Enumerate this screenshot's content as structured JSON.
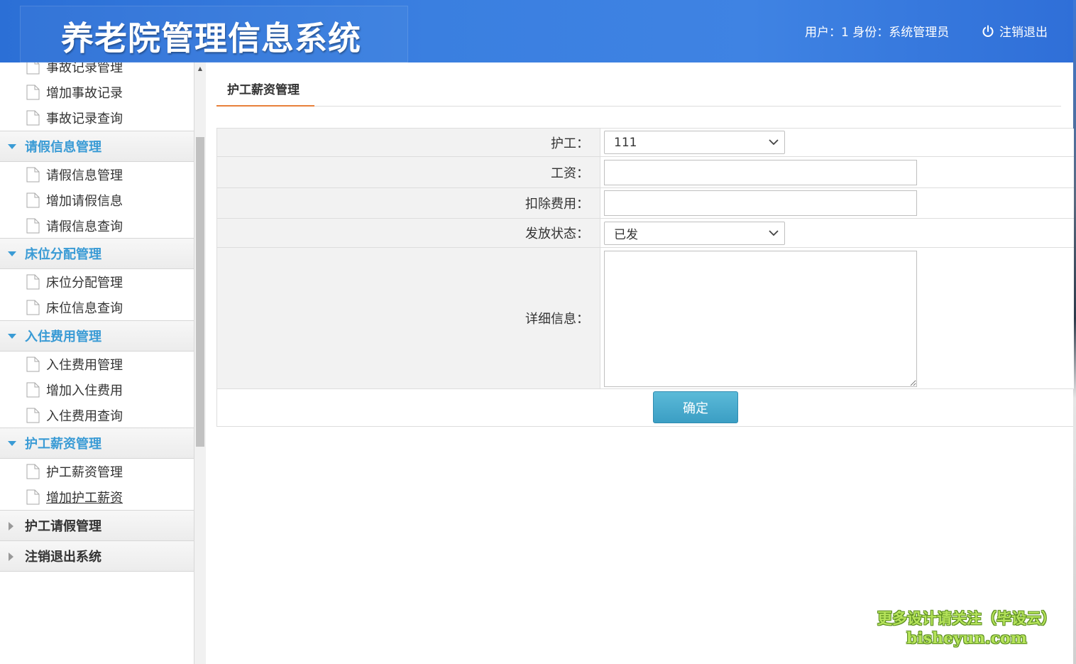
{
  "header": {
    "title": "养老院管理信息系统",
    "user_info": "用户：1 身份：系统管理员",
    "logout_label": "注销退出"
  },
  "sidebar": {
    "partial_top_item": "事故记录管理",
    "items_top": [
      "增加事故记录",
      "事故记录查询"
    ],
    "groups": [
      {
        "label": "请假信息管理",
        "state": "open",
        "items": [
          "请假信息管理",
          "增加请假信息",
          "请假信息查询"
        ]
      },
      {
        "label": "床位分配管理",
        "state": "open",
        "items": [
          "床位分配管理",
          "床位信息查询"
        ]
      },
      {
        "label": "入住费用管理",
        "state": "open",
        "items": [
          "入住费用管理",
          "增加入住费用",
          "入住费用查询"
        ]
      },
      {
        "label": "护工薪资管理",
        "state": "open",
        "items": [
          "护工薪资管理",
          "增加护工薪资"
        ]
      },
      {
        "label": "护工请假管理",
        "state": "closed",
        "items": []
      },
      {
        "label": "注销退出系统",
        "state": "closed",
        "items": []
      }
    ]
  },
  "main": {
    "tab_label": "护工薪资管理",
    "form": {
      "nurse_label": "护工：",
      "nurse_value": "111",
      "salary_label": "工资：",
      "salary_value": "",
      "deduction_label": "扣除费用：",
      "deduction_value": "",
      "status_label": "发放状态：",
      "status_value": "已发",
      "detail_label": "详细信息：",
      "detail_value": ""
    },
    "submit_label": "确定"
  },
  "watermark": {
    "line1": "更多设计请关注（毕设云）",
    "line2": "bisheyun.com"
  },
  "colors": {
    "header_blue": "#3a7fe0",
    "group_open_text": "#3a9bd5",
    "tab_underline": "#e8803a",
    "button_blue": "#3b9ec4"
  }
}
